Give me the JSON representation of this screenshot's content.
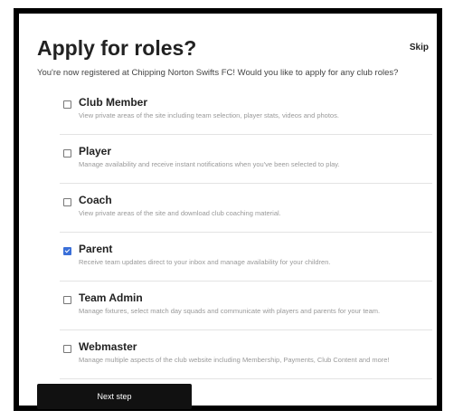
{
  "header": {
    "title": "Apply for roles?",
    "skip_label": "Skip"
  },
  "intro": "You're now registered at Chipping Norton Swifts FC! Would you like to apply for any club roles?",
  "roles": [
    {
      "name": "Club Member",
      "description": "View private areas of the site including team selection, player stats, videos and photos.",
      "checked": false
    },
    {
      "name": "Player",
      "description": "Manage availability and receive instant notifications when you've been selected to play.",
      "checked": false
    },
    {
      "name": "Coach",
      "description": "View private areas of the site and download club coaching material.",
      "checked": false
    },
    {
      "name": "Parent",
      "description": "Receive team updates direct to your inbox and manage availability for your children.",
      "checked": true
    },
    {
      "name": "Team Admin",
      "description": "Manage fixtures, select match day squads and communicate with players and parents for your team.",
      "checked": false
    },
    {
      "name": "Webmaster",
      "description": "Manage multiple aspects of the club website including Membership, Payments, Club Content and more!",
      "checked": false
    }
  ],
  "footer": {
    "next_label": "Next step"
  },
  "colors": {
    "checkbox_checked": "#3a6fd8",
    "button_bg": "#111111"
  }
}
